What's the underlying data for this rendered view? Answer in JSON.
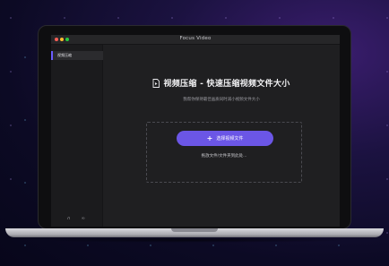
{
  "window": {
    "title": "Focus Video"
  },
  "sidebar": {
    "items": [
      {
        "label": "视频压缩",
        "active": true
      }
    ],
    "footer_icons": [
      "headphones-icon",
      "link-icon"
    ]
  },
  "main": {
    "heading": "视频压缩 - 快速压缩视频文件大小",
    "subtitle": "我帮你保持最佳画质同时减小视频文件大小",
    "select_button_label": "选择视频文件",
    "drop_hint": "拖放文件/文件夹到此处..."
  },
  "colors": {
    "accent": "#6b56e6",
    "window_bg": "#1f1f21",
    "sidebar_bg": "#1b1b1d"
  }
}
